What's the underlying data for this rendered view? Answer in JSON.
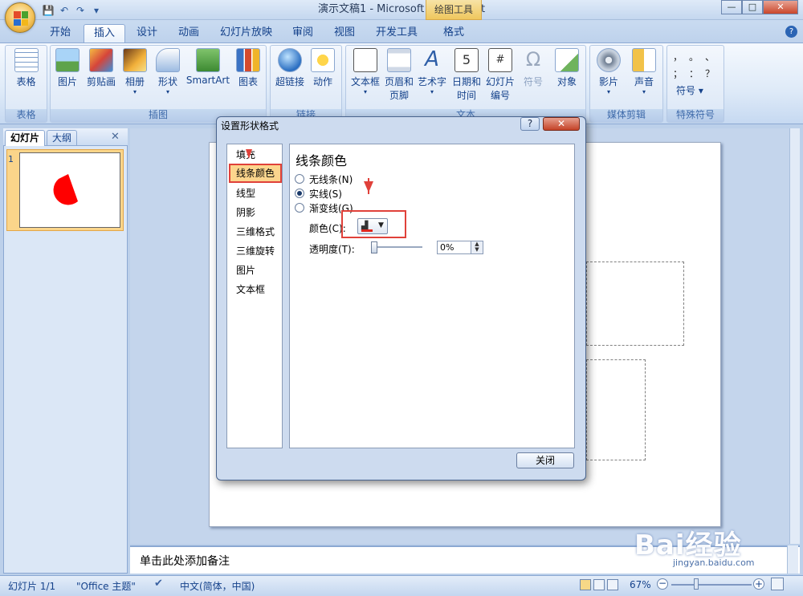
{
  "window": {
    "title": "演示文稿1 - Microsoft PowerPoint",
    "contextual_tab": "绘图工具",
    "minimize": "—",
    "maximize": "□",
    "close": "✕"
  },
  "quick_access": {
    "save": "💾",
    "undo": "↶",
    "redo": "↷",
    "more": "▾"
  },
  "tabs": [
    "开始",
    "插入",
    "设计",
    "动画",
    "幻灯片放映",
    "审阅",
    "视图",
    "开发工具",
    "格式"
  ],
  "active_tab": "插入",
  "ribbon": {
    "groups": [
      {
        "label": "表格",
        "buttons": [
          "表格"
        ]
      },
      {
        "label": "插图",
        "buttons": [
          "图片",
          "剪贴画",
          "相册",
          "形状",
          "SmartArt",
          "图表"
        ]
      },
      {
        "label": "链接",
        "buttons": [
          "超链接",
          "动作"
        ]
      },
      {
        "label": "文本",
        "buttons": [
          "文本框",
          "页眉和页脚",
          "艺术字",
          "日期和时间",
          "幻灯片编号",
          "符号",
          "对象"
        ]
      },
      {
        "label": "媒体剪辑",
        "buttons": [
          "影片",
          "声音"
        ]
      },
      {
        "label": "特殊符号",
        "buttons": [
          "符号"
        ]
      }
    ],
    "special_symbols": [
      "，",
      "。",
      "、",
      "；",
      "：",
      "？"
    ]
  },
  "left_pane": {
    "tabs": [
      "幻灯片",
      "大纲"
    ],
    "close": "✕",
    "slide_number": "1"
  },
  "notes_placeholder": "单击此处添加备注",
  "status": {
    "slide": "幻灯片 1/1",
    "theme": "\"Office 主题\"",
    "language": "中文(简体，中国)",
    "zoom": "67%"
  },
  "dialog": {
    "title": "设置形状格式",
    "help": "?",
    "close_x": "✕",
    "nav": [
      "填充",
      "线条颜色",
      "线型",
      "阴影",
      "三维格式",
      "三维旋转",
      "图片",
      "文本框"
    ],
    "selected_nav": "线条颜色",
    "heading": "线条颜色",
    "options": [
      {
        "label": "无线条(N)",
        "checked": false
      },
      {
        "label": "实线(S)",
        "checked": true
      },
      {
        "label": "渐变线(G)",
        "checked": false
      }
    ],
    "color_label": "颜色(C):",
    "transparency_label": "透明度(T):",
    "transparency_value": "0%",
    "close_button": "关闭"
  },
  "watermark": {
    "main": "Bai经验",
    "sub": "jingyan.baidu.com"
  },
  "colors": {
    "accent": "#e0413a",
    "ribbon_blue": "#15428b",
    "selection": "#fcd58d"
  }
}
